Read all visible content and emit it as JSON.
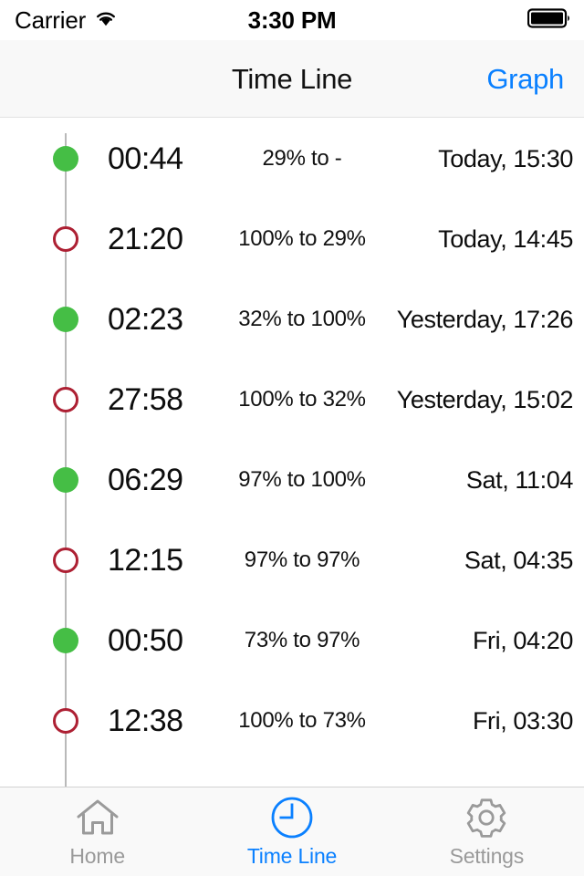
{
  "status_bar": {
    "carrier": "Carrier",
    "time": "3:30 PM",
    "wifi_icon": "wifi-icon",
    "battery_icon": "battery-full-icon"
  },
  "nav_bar": {
    "title": "Time Line",
    "right_button": "Graph"
  },
  "colors": {
    "accent_blue": "#0a80ff",
    "charging_green": "#45be45",
    "discharging_red": "#ad2033",
    "spine_gray": "#b9b9b9"
  },
  "timeline": {
    "rows": [
      {
        "marker": "filled",
        "duration": "00:44",
        "percent": "29% to -",
        "date": "Today, 15:30"
      },
      {
        "marker": "hollow",
        "duration": "21:20",
        "percent": "100% to 29%",
        "date": "Today, 14:45"
      },
      {
        "marker": "filled",
        "duration": "02:23",
        "percent": "32% to 100%",
        "date": "Yesterday, 17:26"
      },
      {
        "marker": "hollow",
        "duration": "27:58",
        "percent": "100% to 32%",
        "date": "Yesterday, 15:02"
      },
      {
        "marker": "filled",
        "duration": "06:29",
        "percent": "97% to 100%",
        "date": "Sat, 11:04"
      },
      {
        "marker": "hollow",
        "duration": "12:15",
        "percent": "97% to 97%",
        "date": "Sat, 04:35"
      },
      {
        "marker": "filled",
        "duration": "00:50",
        "percent": "73% to 97%",
        "date": "Fri, 04:20"
      },
      {
        "marker": "hollow",
        "duration": "12:38",
        "percent": "100% to 73%",
        "date": "Fri, 03:30"
      }
    ]
  },
  "tab_bar": {
    "tabs": [
      {
        "label": "Home",
        "icon": "home-icon",
        "active": false
      },
      {
        "label": "Time Line",
        "icon": "clock-icon",
        "active": true
      },
      {
        "label": "Settings",
        "icon": "gear-icon",
        "active": false
      }
    ]
  }
}
